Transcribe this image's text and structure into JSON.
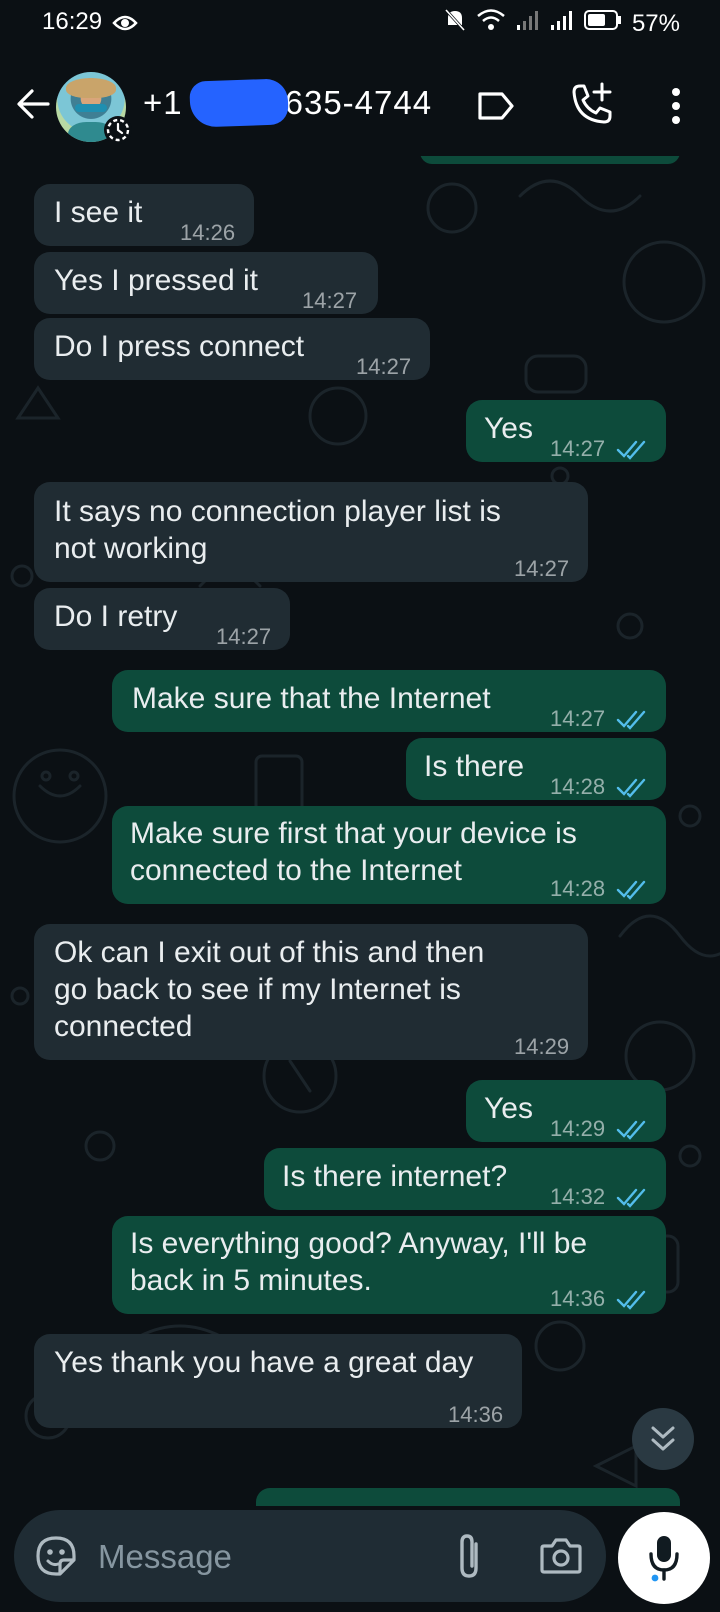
{
  "status_bar": {
    "time": "16:29",
    "battery": "57%"
  },
  "header": {
    "contact_visible_prefix": "+1",
    "contact_visible_suffix": "635-4744"
  },
  "messages": [
    {
      "direction": "in",
      "text": "I see it",
      "time": "14:26"
    },
    {
      "direction": "in",
      "text": "Yes I pressed it",
      "time": "14:27"
    },
    {
      "direction": "in",
      "text": "Do I press connect",
      "time": "14:27"
    },
    {
      "direction": "out",
      "text": "Yes",
      "time": "14:27",
      "read": true
    },
    {
      "direction": "in",
      "text": "It says no connection player list is\nnot working",
      "time": "14:27"
    },
    {
      "direction": "in",
      "text": "Do I retry",
      "time": "14:27"
    },
    {
      "direction": "out",
      "text": "Make sure that the Internet",
      "time": "14:27",
      "read": true
    },
    {
      "direction": "out",
      "text": "Is there",
      "time": "14:28",
      "read": true
    },
    {
      "direction": "out",
      "text": "Make sure first that your device is\nconnected to the Internet",
      "time": "14:28",
      "read": true
    },
    {
      "direction": "in",
      "text": "Ok can I exit out of this and then\ngo back to see if my Internet is\nconnected",
      "time": "14:29"
    },
    {
      "direction": "out",
      "text": "Yes",
      "time": "14:29",
      "read": true
    },
    {
      "direction": "out",
      "text": "Is there internet?",
      "time": "14:32",
      "read": true
    },
    {
      "direction": "out",
      "text": "Is everything good? Anyway, I'll be\nback in 5 minutes.",
      "time": "14:36",
      "read": true
    },
    {
      "direction": "in",
      "text": "Yes thank you have a great day",
      "time": "14:36"
    }
  ],
  "composer": {
    "placeholder": "Message"
  },
  "colors": {
    "incoming_bubble": "#202c33",
    "outgoing_bubble": "#0d4b3b",
    "read_ticks": "#53bdeb",
    "redaction": "#2563ff"
  },
  "icons": {
    "back": "arrow-left-icon",
    "disappearing": "timer-icon",
    "label": "label-icon",
    "call": "add-call-icon",
    "menu": "more-vert-icon",
    "emoji": "sticker-icon",
    "attach": "paperclip-icon",
    "camera": "camera-icon",
    "mic": "mic-icon",
    "scroll": "double-chevron-down-icon"
  }
}
